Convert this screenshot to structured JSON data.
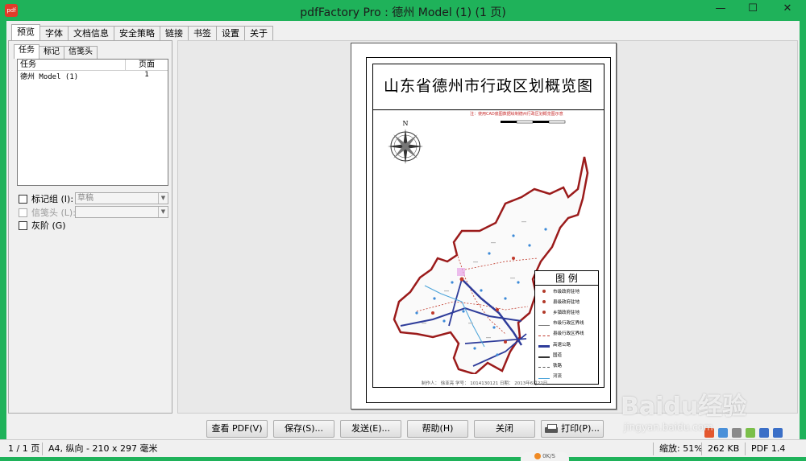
{
  "window": {
    "title": "pdfFactory Pro : 德州 Model (1) (1 页)",
    "app_icon_text": "pdf",
    "minimize_glyph": "—",
    "maximize_glyph": "☐",
    "close_glyph": "✕"
  },
  "tabs": [
    "预览",
    "字体",
    "文档信息",
    "安全策略",
    "链接",
    "书签",
    "设置",
    "关于"
  ],
  "left_panel": {
    "subtabs": [
      "任务",
      "标记",
      "信笺头"
    ],
    "task_headers": [
      "任务",
      "页面"
    ],
    "tasks": [
      {
        "name": "德州 Model (1)",
        "pages": "1"
      }
    ],
    "markgroup": {
      "label": "标记组 (I):",
      "value": "草稿",
      "checked": false,
      "enabled": true
    },
    "letterhead": {
      "label": "信笺头 (L):",
      "value": "",
      "checked": false,
      "enabled": false
    },
    "grayscale": {
      "label": "灰阶 (G)",
      "checked": false
    }
  },
  "document": {
    "map_title": "山东省德州市行政区划概览图",
    "subtitle": "注：使用CAD底图数据绘制德州行政区划概览图示意",
    "legend_title": "图 例",
    "legend_items": [
      {
        "label": "市级政府驻地",
        "symbol": "dot"
      },
      {
        "label": "县级政府驻地",
        "symbol": "dot"
      },
      {
        "label": "乡镇政府驻地",
        "symbol": "dot"
      },
      {
        "label": "市级行政区界线",
        "symbol": "line-thin"
      },
      {
        "label": "县级行政区界线",
        "symbol": "line-red"
      },
      {
        "label": "高速公路",
        "symbol": "line-blue"
      },
      {
        "label": "国道",
        "symbol": "line-black"
      },
      {
        "label": "铁路",
        "symbol": "line-dash"
      },
      {
        "label": "河流",
        "symbol": "line-river"
      }
    ],
    "footer": "制作人： 徐亚亮    学号： 1014130121    日期： 2013年6月22日",
    "compass_letter": "N"
  },
  "buttons": {
    "view_pdf": "查看 PDF(V)",
    "save": "保存(S)...",
    "send": "发送(E)...",
    "help": "帮助(H)",
    "close": "关闭",
    "print": "打印(P)..."
  },
  "status": {
    "page": "1 / 1 页",
    "paper": "A4, 纵向 - 210 x 297 毫米",
    "zoom": "缩放: 51%",
    "size": "262 KB",
    "version": "PDF 1.4"
  },
  "badge": {
    "text": "0K/S"
  },
  "watermark": {
    "brand": "Baidu经验",
    "url": "jingyan.baidu.com"
  },
  "colors": {
    "window_chrome": "#1fb25a",
    "boundary": "#9b1b1b",
    "road": "#2e3c9a",
    "river": "#4aa3d9"
  }
}
